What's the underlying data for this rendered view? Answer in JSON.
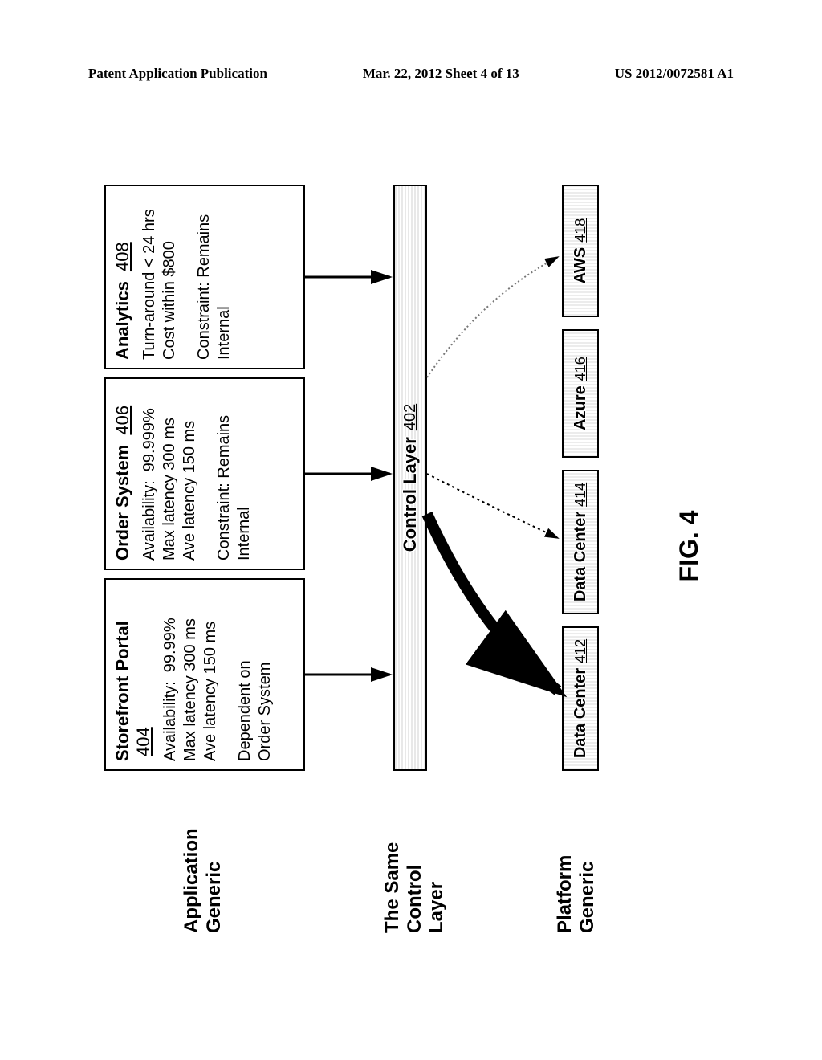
{
  "header": {
    "left": "Patent Application Publication",
    "center": "Mar. 22, 2012   Sheet 4 of 13",
    "right": "US 2012/0072581 A1"
  },
  "row_labels": {
    "application": "Application\nGeneric",
    "control": "The Same\nControl\nLayer",
    "platform": "Platform\nGeneric"
  },
  "apps": {
    "storefront": {
      "title": "Storefront Portal",
      "ref": "404",
      "metrics": "Availability:  99.99%\nMax latency 300 ms\nAve latency 150 ms",
      "constraint": "Dependent on\nOrder System"
    },
    "order": {
      "title": "Order System",
      "ref": "406",
      "metrics": "Availability:  99.999%\nMax latency 300 ms\nAve latency 150 ms",
      "constraint": "Constraint: Remains\nInternal"
    },
    "analytics": {
      "title": "Analytics",
      "ref": "408",
      "metrics": "Turn-around < 24 hrs\nCost within $800",
      "constraint": "Constraint: Remains\nInternal"
    }
  },
  "control_layer": {
    "label": "Control Layer",
    "ref": "402"
  },
  "platforms": {
    "dc1": {
      "label": "Data Center",
      "ref": "412"
    },
    "dc2": {
      "label": "Data Center",
      "ref": "414"
    },
    "azure": {
      "label": "Azure",
      "ref": "416"
    },
    "aws": {
      "label": "AWS",
      "ref": "418"
    }
  },
  "figure_label": "FIG. 4"
}
